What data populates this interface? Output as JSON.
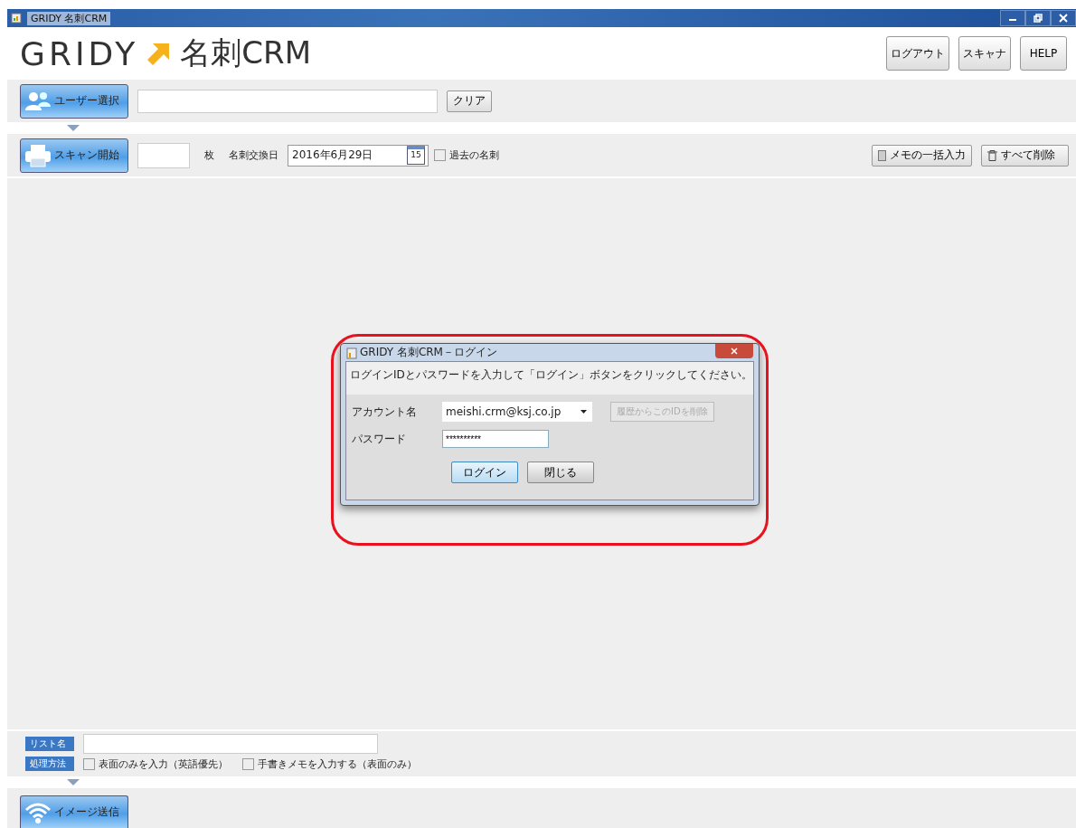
{
  "window": {
    "title": "GRIDY 名刺CRM"
  },
  "logo": {
    "brand": "GRIDY",
    "product": "名刺CRM"
  },
  "header_buttons": [
    "ログアウト",
    "スキャナ",
    "HELP"
  ],
  "user_row": {
    "button": "ユーザー選択",
    "clear": "クリア"
  },
  "scan_row": {
    "button": "スキャン開始",
    "unit": "枚",
    "date_label": "名刺交換日",
    "date": "2016年6月29日",
    "calendar_day": "15",
    "past_cards": {
      "label": "過去の名刺",
      "checked": false
    },
    "memo_button": "メモの一括入力",
    "delete_button": "すべて削除"
  },
  "dialog": {
    "title": "GRIDY 名刺CRM－ログイン",
    "message": "ログインIDとパスワードを入力して「ログイン」ボタンをクリックしてください。",
    "account_label": "アカウント名",
    "account": "meishi.crm@ksj.co.jp",
    "remove_button": {
      "label": "履歴からこのIDを削除",
      "disabled": true
    },
    "password_label": "パスワード",
    "password": "**********",
    "login": "ログイン",
    "close": "閉じる"
  },
  "bottom": {
    "list_label": "リスト名",
    "method_label": "処理方法",
    "options": [
      {
        "label": "表面のみを入力（英語優先）",
        "checked": false
      },
      {
        "label": "手書きメモを入力する（表面のみ）",
        "checked": false
      }
    ],
    "send_button": "イメージ送信"
  }
}
